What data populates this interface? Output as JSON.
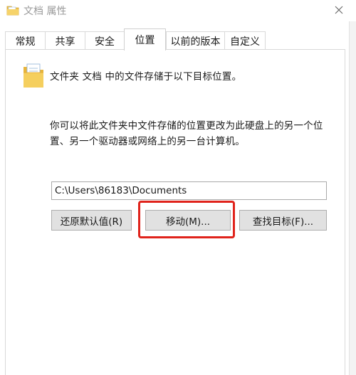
{
  "window": {
    "title": "文档 属性"
  },
  "tabs": [
    {
      "label": "常规",
      "active": false
    },
    {
      "label": "共享",
      "active": false
    },
    {
      "label": "安全",
      "active": false
    },
    {
      "label": "位置",
      "active": true
    },
    {
      "label": "以前的版本",
      "active": false
    },
    {
      "label": "自定义",
      "active": false
    }
  ],
  "location": {
    "intro": "文件夹 文档 中的文件存储于以下目标位置。",
    "description": "你可以将此文件夹中文件存储的位置更改为此硬盘上的另一个位置、另一个驱动器或网络上的另一台计算机。",
    "path_value": "C:\\Users\\86183\\Documents",
    "buttons": {
      "restore": "还原默认值(R)",
      "move": "移动(M)...",
      "find_target": "查找目标(F)..."
    }
  },
  "icons": {
    "title_icon": "folder-icon",
    "close": "close-icon",
    "location_icon": "folder-icon"
  },
  "colors": {
    "highlight": "#e0231b",
    "folder": "#f0c24b"
  }
}
